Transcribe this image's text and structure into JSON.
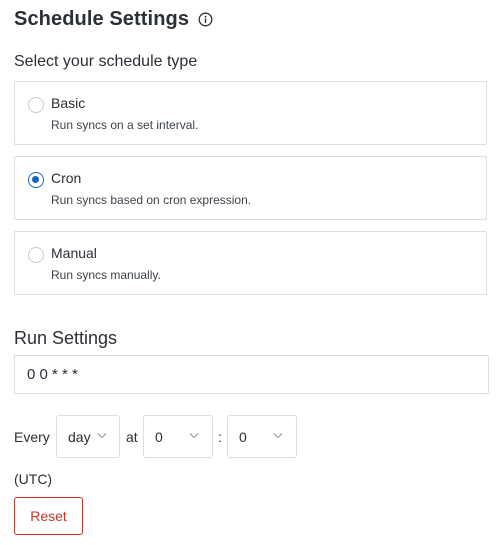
{
  "header": {
    "title": "Schedule Settings",
    "info_icon": "info-icon"
  },
  "schedule_type": {
    "label": "Select your schedule type",
    "selected": "Cron",
    "options": [
      {
        "label": "Basic",
        "description": "Run syncs on a set interval.",
        "checked": false
      },
      {
        "label": "Cron",
        "description": "Run syncs based on cron expression.",
        "checked": true
      },
      {
        "label": "Manual",
        "description": "Run syncs manually.",
        "checked": false
      }
    ]
  },
  "run_settings": {
    "title": "Run Settings",
    "cron_expression": "0 0 * * *",
    "every_label": "Every",
    "frequency_value": "day",
    "at_label": "at",
    "hour_value": "0",
    "separator": ":",
    "minute_value": "0",
    "timezone": "(UTC)"
  },
  "actions": {
    "reset_label": "Reset"
  },
  "colors": {
    "accent": "#1565c0",
    "danger": "#c0392b",
    "border": "#d9dce1",
    "text": "#2b2f36"
  }
}
